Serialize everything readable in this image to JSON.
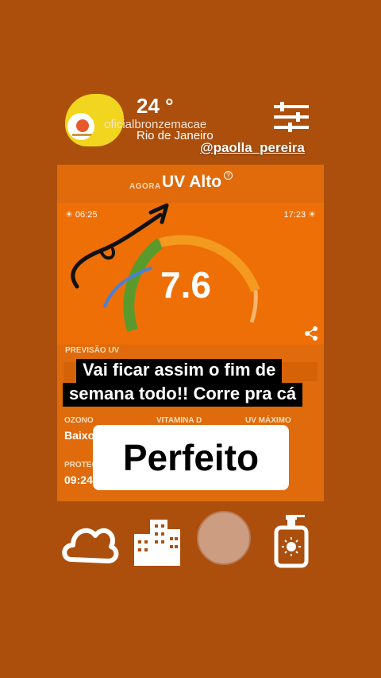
{
  "header": {
    "temperature": "24 °",
    "username": "oficialbronzemacae",
    "city": "Rio de Janeiro",
    "tag": "@paolla_pereira"
  },
  "uv": {
    "now_label": "AGORA",
    "level": "UV Alto",
    "help": "?",
    "sunrise": "☀ 06:25",
    "sunset": "17:23 ☀",
    "value": "7.6",
    "forecast_label": "PREVISÃO UV",
    "ozone_label": "OZONO",
    "ozone_value": "Baixo",
    "vitamin_label": "VITAMINA D",
    "max_label": "UV MÁXIMO",
    "protect_label": "PROTEÇ",
    "protect_value": "09:24"
  },
  "captions": {
    "line1": "Vai ficar assim o fim de",
    "line2": "semana todo!! Corre pra cá",
    "sticker": "Perfeito"
  },
  "bottom_nav": [
    "cloud-icon",
    "buildings-icon",
    "avatar-circle",
    "sunscreen-icon"
  ],
  "colors": {
    "background": "#ac4f0d",
    "card": "#df6b0c",
    "gauge_green": "#5a9a2c",
    "gauge_orange": "#f39a1f"
  }
}
